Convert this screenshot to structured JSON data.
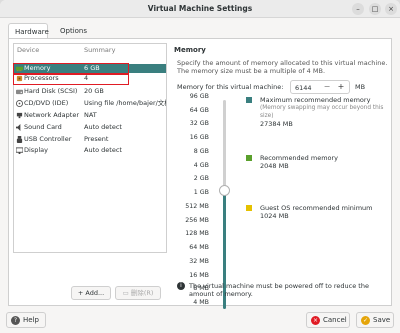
{
  "window": {
    "title": "Virtual Machine Settings",
    "minimize": "–",
    "maximize": "□",
    "close": "×"
  },
  "tabs": [
    {
      "label": "Hardware"
    },
    {
      "label": "Options"
    }
  ],
  "device_list": {
    "columns": {
      "device": "Device",
      "summary": "Summary"
    },
    "items": [
      {
        "name": "Memory",
        "summary": "6 GB",
        "icon": "memory-icon"
      },
      {
        "name": "Processors",
        "summary": "4",
        "icon": "processor-icon"
      },
      {
        "name": "Hard Disk (SCSI)",
        "summary": "20 GB",
        "icon": "hard-disk-icon"
      },
      {
        "name": "CD/DVD (IDE)",
        "summary": "Using file /home/bajer/文档",
        "icon": "cd-dvd-icon"
      },
      {
        "name": "Network Adapter",
        "summary": "NAT",
        "icon": "network-icon"
      },
      {
        "name": "Sound Card",
        "summary": "Auto detect",
        "icon": "sound-icon"
      },
      {
        "name": "USB Controller",
        "summary": "Present",
        "icon": "usb-icon"
      },
      {
        "name": "Display",
        "summary": "Auto detect",
        "icon": "display-icon"
      }
    ],
    "selected_index": 0,
    "add_label": "Add...",
    "remove_label": "删除(R)"
  },
  "memory": {
    "section_title": "Memory",
    "description": "Specify the amount of memory allocated to this virtual machine. The memory size must be a multiple of 4 MB.",
    "field_label": "Memory for this virtual machine:",
    "value": "6144",
    "unit": "MB",
    "ticks": [
      "96 GB",
      "64 GB",
      "32 GB",
      "16 GB",
      "8 GB",
      "4 GB",
      "2 GB",
      "1 GB",
      "512 MB",
      "256 MB",
      "128 MB",
      "64 MB",
      "32 MB",
      "16 MB",
      "8 MB",
      "4 MB"
    ],
    "slider_value_fraction": 0.57,
    "legend": {
      "max_recommended_label": "Maximum recommended memory",
      "max_recommended_sub": "(Memory swapping may occur beyond this size)",
      "max_recommended_value": "27384 MB",
      "recommended_label": "Recommended memory",
      "recommended_value": "2048 MB",
      "guest_min_label": "Guest OS recommended minimum",
      "guest_min_value": "1024 MB"
    },
    "colors": {
      "max": "#3a7f7f",
      "recommended": "#5aa02c",
      "guest_min": "#e5c100"
    },
    "note": "The virtual machine must be powered off to reduce the amount of memory."
  },
  "footer": {
    "help_label": "Help",
    "cancel_label": "Cancel",
    "save_label": "Save"
  }
}
